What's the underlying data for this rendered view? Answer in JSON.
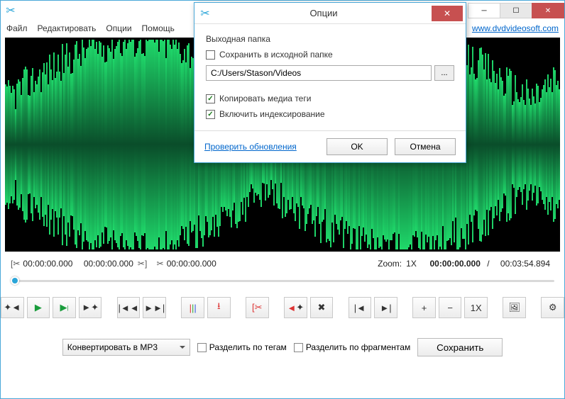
{
  "menu": {
    "file": "Файл",
    "edit": "Редактировать",
    "options": "Опции",
    "help": "Помощь"
  },
  "link": "www.dvdvideosoft.com",
  "time": {
    "sel_start": "00:00:00.000",
    "sel_end": "00:00:00.000",
    "cursor": "00:00:00.000",
    "zoom_label": "Zoom:",
    "zoom_value": "1X",
    "position": "00:00:00.000",
    "sep": "/",
    "duration": "00:03:54.894"
  },
  "toolbar": {
    "one_x": "1X"
  },
  "bottom": {
    "convert_label": "Конвертировать в MP3",
    "split_tags": "Разделить по тегам",
    "split_fragments": "Разделить по фрагментам",
    "save": "Сохранить"
  },
  "modal": {
    "title": "Опции",
    "section": "Выходная папка",
    "save_source": "Сохранить в исходной папке",
    "path": "C:/Users/Stason/Videos",
    "browse": "...",
    "copy_tags": "Копировать медиа теги",
    "enable_index": "Включить индексирование",
    "check_updates": "Проверить обновления",
    "ok": "OK",
    "cancel": "Отмена"
  }
}
